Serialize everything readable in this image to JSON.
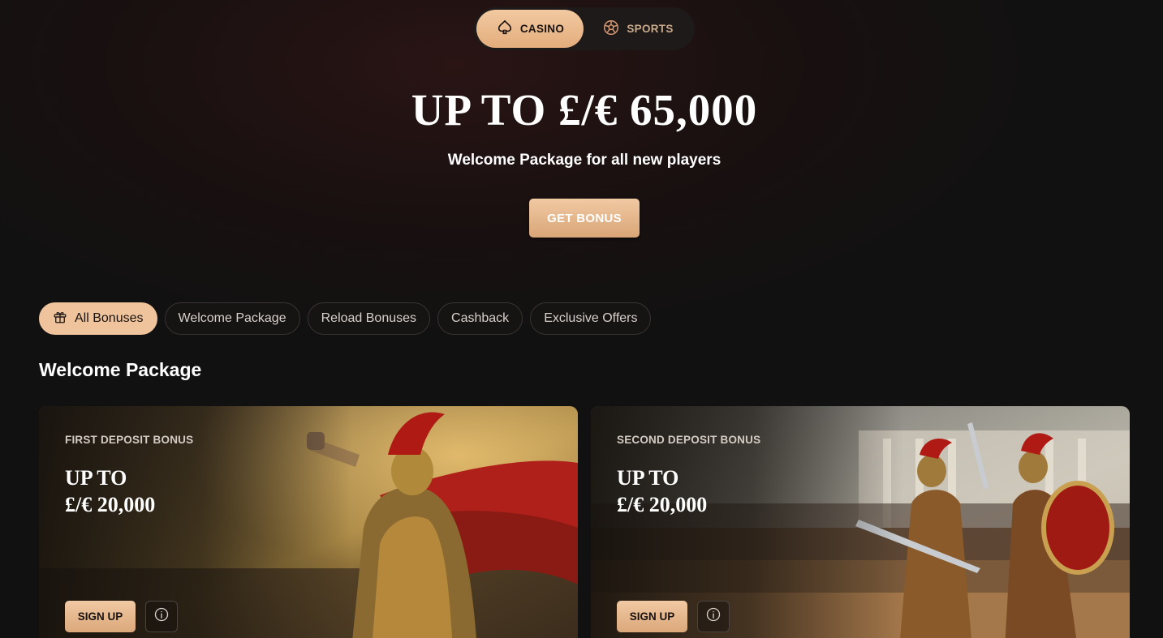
{
  "top_toggle": {
    "casino_label": "CASINO",
    "casino_icon": "spade-icon",
    "sports_label": "SPORTS",
    "sports_icon": "soccer-ball-icon"
  },
  "hero": {
    "title": "UP TO £/€ 65,000",
    "subtitle": "Welcome Package for all new players",
    "cta_label": "GET BONUS"
  },
  "filters": [
    {
      "label": "All Bonuses",
      "icon": "gift-icon",
      "active": true
    },
    {
      "label": "Welcome Package",
      "active": false
    },
    {
      "label": "Reload Bonuses",
      "active": false
    },
    {
      "label": "Cashback",
      "active": false
    },
    {
      "label": "Exclusive Offers",
      "active": false
    }
  ],
  "section": {
    "title": "Welcome Package"
  },
  "cards": [
    {
      "kicker": "FIRST DEPOSIT BONUS",
      "title_line1": "UP TO",
      "title_line2": "£/€ 20,000",
      "signup_label": "SIGN UP",
      "info_icon": "info-icon"
    },
    {
      "kicker": "SECOND DEPOSIT BONUS",
      "title_line1": "UP TO",
      "title_line2": "£/€ 20,000",
      "signup_label": "SIGN UP",
      "info_icon": "info-icon"
    }
  ],
  "colors": {
    "accent": "#efc49c",
    "background": "#121111",
    "hero_glow": "#2a1414"
  }
}
